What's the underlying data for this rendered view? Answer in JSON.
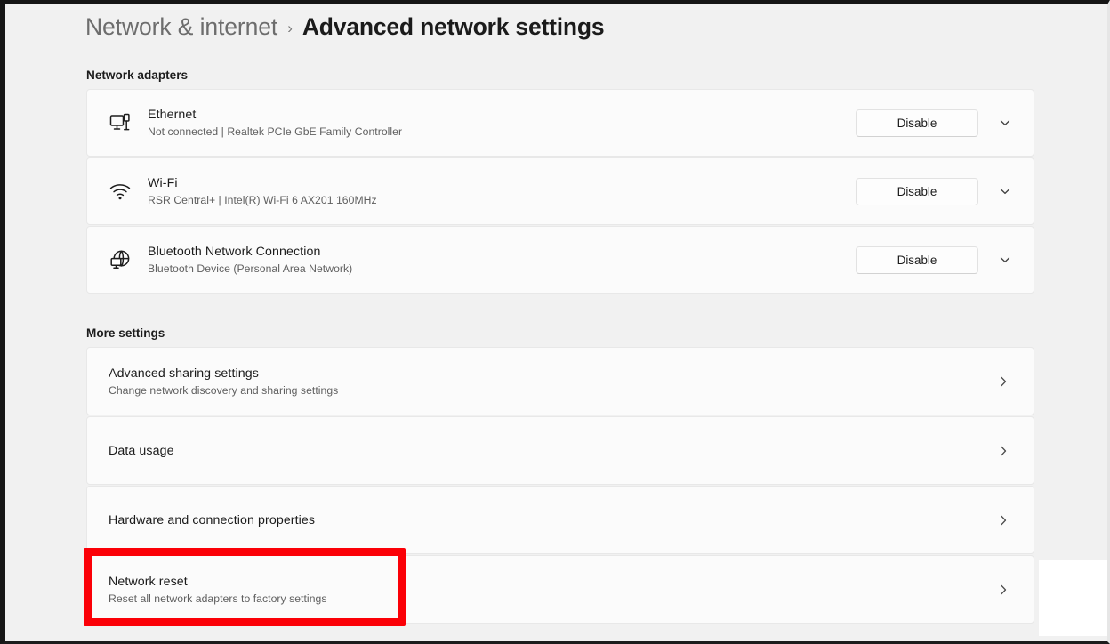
{
  "breadcrumb": {
    "parent": "Network & internet",
    "separator": "›",
    "current": "Advanced network settings"
  },
  "sections": {
    "adapters": {
      "heading": "Network adapters",
      "items": [
        {
          "icon": "ethernet-icon",
          "title": "Ethernet",
          "subtitle": "Not connected | Realtek PCIe GbE Family Controller",
          "button_label": "Disable",
          "expander": "chevron-down-icon"
        },
        {
          "icon": "wifi-icon",
          "title": "Wi-Fi",
          "subtitle": "RSR Central+ | Intel(R) Wi-Fi 6 AX201 160MHz",
          "button_label": "Disable",
          "expander": "chevron-down-icon"
        },
        {
          "icon": "bluetooth-network-icon",
          "title": "Bluetooth Network Connection",
          "subtitle": "Bluetooth Device (Personal Area Network)",
          "button_label": "Disable",
          "expander": "chevron-down-icon"
        }
      ]
    },
    "more": {
      "heading": "More settings",
      "items": [
        {
          "title": "Advanced sharing settings",
          "subtitle": "Change network discovery and sharing settings",
          "navigate": "chevron-right-icon",
          "highlighted": false
        },
        {
          "title": "Data usage",
          "subtitle": "",
          "navigate": "chevron-right-icon",
          "highlighted": false
        },
        {
          "title": "Hardware and connection properties",
          "subtitle": "",
          "navigate": "chevron-right-icon",
          "highlighted": false
        },
        {
          "title": "Network reset",
          "subtitle": "Reset all network adapters to factory settings",
          "navigate": "chevron-right-icon",
          "highlighted": true
        }
      ]
    }
  },
  "annotation": {
    "highlight_color": "#fb0007",
    "target": "Network reset"
  },
  "colors": {
    "page_background": "#f1f1f1",
    "card_background": "#fbfbfb",
    "card_border": "#e8e8e8",
    "text_primary": "#1b1b1b",
    "text_secondary": "#5f5f5f",
    "breadcrumb_parent": "#6d6d6d"
  }
}
